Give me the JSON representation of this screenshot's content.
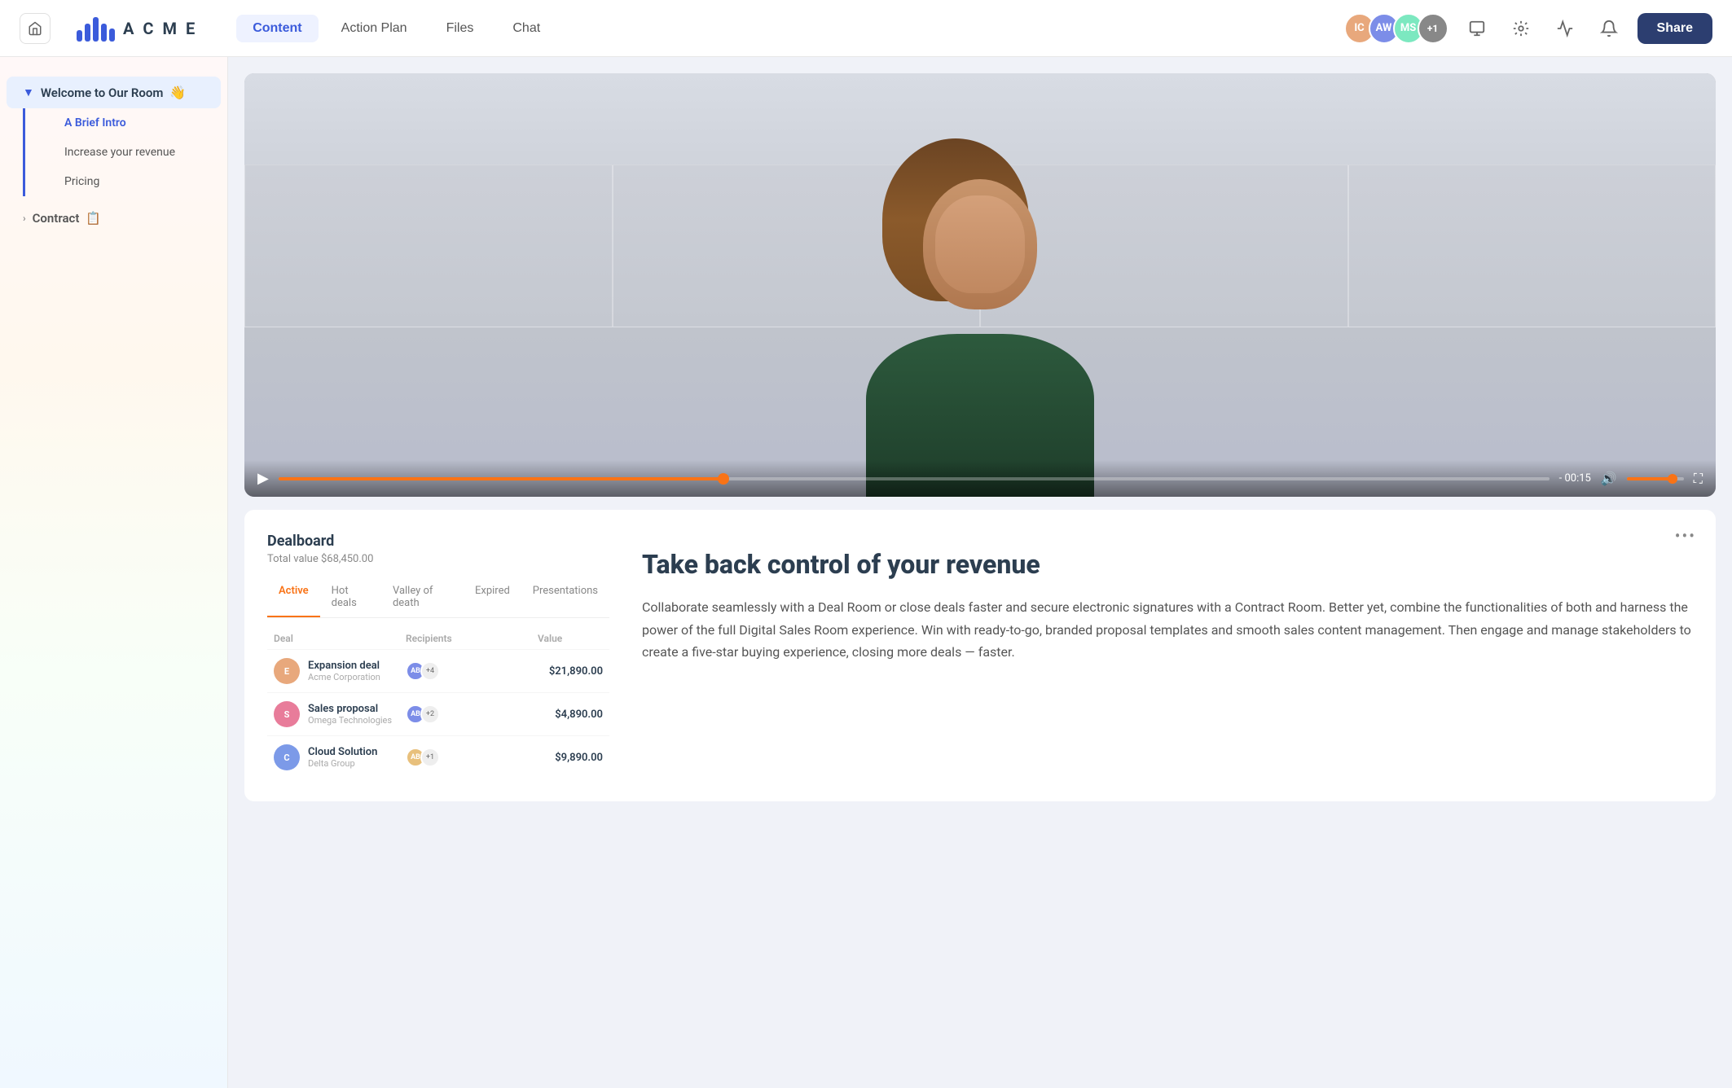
{
  "navbar": {
    "logo_text": "A C M E",
    "home_label": "Home",
    "tabs": [
      {
        "id": "content",
        "label": "Content",
        "active": true
      },
      {
        "id": "action-plan",
        "label": "Action Plan",
        "active": false
      },
      {
        "id": "files",
        "label": "Files",
        "active": false
      },
      {
        "id": "chat",
        "label": "Chat",
        "active": false
      }
    ],
    "avatars": [
      {
        "id": "ic",
        "initials": "IC",
        "class": "avatar-ic"
      },
      {
        "id": "aw",
        "initials": "AW",
        "class": "avatar-aw"
      },
      {
        "id": "ms",
        "initials": "MS",
        "class": "avatar-ms"
      },
      {
        "id": "plus",
        "initials": "+1",
        "class": "avatar-plus"
      }
    ],
    "share_label": "Share"
  },
  "sidebar": {
    "section_welcome": {
      "title": "Welcome to Our Room",
      "emoji": "👋",
      "items": [
        {
          "id": "brief-intro",
          "label": "A Brief Intro",
          "active": true
        },
        {
          "id": "increase-revenue",
          "label": "Increase your revenue",
          "active": false
        },
        {
          "id": "pricing",
          "label": "Pricing",
          "active": false
        }
      ]
    },
    "section_contract": {
      "title": "Contract",
      "emoji": "📋"
    }
  },
  "video": {
    "time": "- 00:15",
    "progress_pct": 35,
    "volume_pct": 80
  },
  "dealboard": {
    "title": "Dealboard",
    "subtitle": "Total value $68,450.00",
    "tabs": [
      {
        "id": "active",
        "label": "Active",
        "active": true
      },
      {
        "id": "hot-deals",
        "label": "Hot deals",
        "active": false
      },
      {
        "id": "valley-of-death",
        "label": "Valley of death",
        "active": false
      },
      {
        "id": "expired",
        "label": "Expired",
        "active": false
      },
      {
        "id": "presentations",
        "label": "Presentations",
        "active": false
      }
    ],
    "table_headers": [
      "Deal",
      "Recipients",
      "Value"
    ],
    "rows": [
      {
        "id": "row-1",
        "deal_name": "Expansion deal",
        "company": "Acme Corporation",
        "avatar_letter": "E",
        "avatar_class": "",
        "rec_plus": "+4",
        "value": "$21,890.00"
      },
      {
        "id": "row-2",
        "deal_name": "Sales proposal",
        "company": "Omega Technologies",
        "avatar_letter": "S",
        "avatar_class": "pink",
        "rec_plus": "+2",
        "value": "$4,890.00"
      },
      {
        "id": "row-3",
        "deal_name": "Cloud Solution",
        "company": "Delta Group",
        "avatar_letter": "C",
        "avatar_class": "blue",
        "rec_plus": "+1",
        "value": "$9,890.00"
      }
    ],
    "heading": "Take back control of your revenue",
    "description": "Collaborate seamlessly with a Deal Room or close deals faster and secure electronic signatures with a Contract Room. Better yet, combine the functionalities of both and harness the power of the full Digital Sales Room experience. Win with ready-to-go, branded proposal templates and smooth sales content management. Then engage and manage stakeholders to create a five-star buying experience, closing more deals — faster."
  }
}
